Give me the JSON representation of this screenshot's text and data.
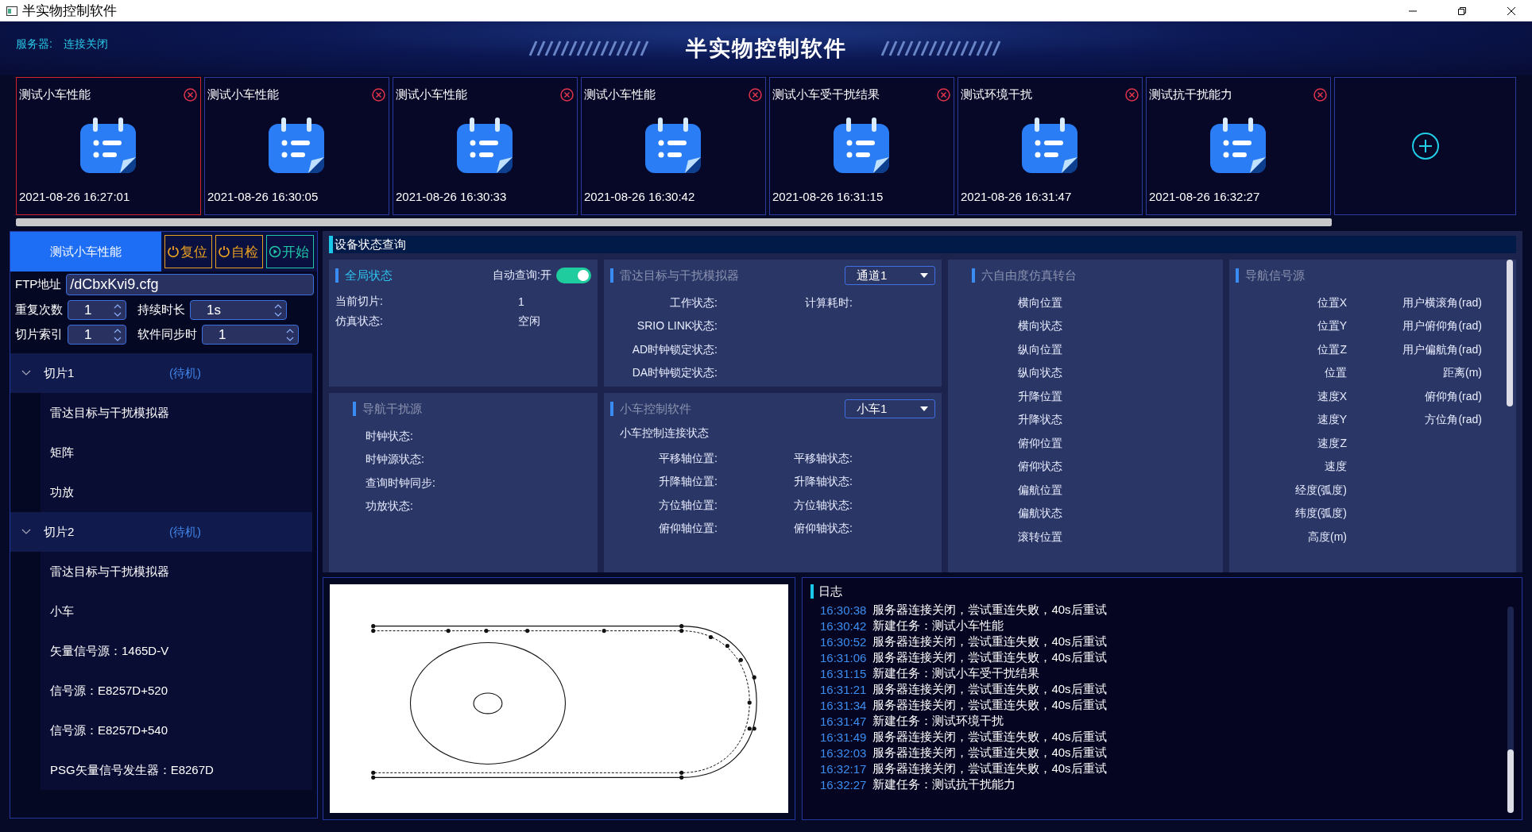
{
  "window": {
    "title": "半实物控制软件"
  },
  "header": {
    "server_label": "服务器:",
    "server_status": "连接关闭",
    "title": "半实物控制软件"
  },
  "tasks": [
    {
      "name": "测试小车性能",
      "time": "2021-08-26 16:27:01",
      "selected": true
    },
    {
      "name": "测试小车性能",
      "time": "2021-08-26 16:30:05",
      "selected": false
    },
    {
      "name": "测试小车性能",
      "time": "2021-08-26 16:30:33",
      "selected": false
    },
    {
      "name": "测试小车性能",
      "time": "2021-08-26 16:30:42",
      "selected": false
    },
    {
      "name": "测试小车受干扰结果",
      "time": "2021-08-26 16:31:15",
      "selected": false
    },
    {
      "name": "测试环境干扰",
      "time": "2021-08-26 16:31:47",
      "selected": false
    },
    {
      "name": "测试抗干扰能力",
      "time": "2021-08-26 16:32:27",
      "selected": false
    }
  ],
  "task_panel": {
    "name": "测试小车性能",
    "buttons": [
      {
        "label": "复位",
        "kind": "reset"
      },
      {
        "label": "自检",
        "kind": "reset"
      },
      {
        "label": "开始",
        "kind": "start"
      }
    ],
    "ftp": {
      "label": "FTP地址",
      "value": "/dCbxKvi9.cfg"
    },
    "fields": [
      {
        "label": "重复次数",
        "value": "1"
      },
      {
        "label": "持续时长",
        "value": "1s"
      },
      {
        "label": "切片索引",
        "value": "1"
      },
      {
        "label": "软件同步时",
        "value": "1"
      }
    ]
  },
  "slices": [
    {
      "name": "切片1",
      "status": "(待机)",
      "expanded": true,
      "children": [
        {
          "name": "雷达目标与干扰模拟器"
        },
        {
          "name": "矩阵"
        },
        {
          "name": "功放"
        }
      ]
    },
    {
      "name": "切片2",
      "status": "(待机)",
      "expanded": true,
      "children": [
        {
          "name": "雷达目标与干扰模拟器"
        },
        {
          "name": "小车"
        },
        {
          "name": "矢量信号源：1465D-V"
        },
        {
          "name": "信号源：E8257D+520"
        },
        {
          "name": "信号源：E8257D+540"
        },
        {
          "name": "PSG矢量信号发生器：E8267D"
        }
      ]
    }
  ],
  "device_status": {
    "title": "设备状态查询",
    "panels": [
      {
        "kind": "summary",
        "title": "全局状态",
        "active": true,
        "toggle": {
          "label": "自动查询:开",
          "on": true
        },
        "rows": [
          [
            "当前切片:",
            "1"
          ],
          [
            "仿真状态:",
            "空闲"
          ]
        ]
      },
      {
        "kind": "pairs",
        "title": "雷达目标与干扰模拟器",
        "active": false,
        "dropdown": "通道1",
        "rows": [
          [
            "工作状态:",
            "计算耗时:"
          ],
          [
            "SRIO LINK状态:"
          ],
          [
            "AD时钟锁定状态:"
          ],
          [
            "DA时钟锁定状态:"
          ]
        ]
      },
      {
        "kind": "list",
        "title": "六自由度仿真转台",
        "active": false,
        "rows": [
          [
            "横向位置"
          ],
          [
            "横向状态"
          ],
          [
            "纵向位置"
          ],
          [
            "纵向状态"
          ],
          [
            "升降位置"
          ],
          [
            "升降状态"
          ],
          [
            "俯仰位置"
          ],
          [
            "俯仰状态"
          ],
          [
            "偏航位置"
          ],
          [
            "偏航状态"
          ],
          [
            "滚转位置"
          ]
        ]
      },
      {
        "kind": "pairs",
        "title": "导航信号源",
        "active": false,
        "rows": [
          [
            "位置X",
            "用户横滚角(rad)"
          ],
          [
            "位置Y",
            "用户俯仰角(rad)"
          ],
          [
            "位置Z",
            "用户偏航角(rad)"
          ],
          [
            "位置",
            "距离(m)"
          ],
          [
            "速度X",
            "俯仰角(rad)"
          ],
          [
            "速度Y",
            "方位角(rad)"
          ],
          [
            "速度Z"
          ],
          [
            "速度"
          ],
          [
            "经度(弧度)"
          ],
          [
            "纬度(弧度)"
          ],
          [
            "高度(m)"
          ]
        ]
      },
      {
        "kind": "list",
        "title": "导航干扰源",
        "active": false,
        "rows": [
          [
            "时钟状态:"
          ],
          [
            "时钟源状态:"
          ],
          [
            "查询时钟同步:"
          ],
          [
            "功放状态:"
          ]
        ]
      },
      {
        "kind": "pairs",
        "title": "小车控制软件",
        "active": false,
        "dropdown": "小车1",
        "lines": [
          "小车控制连接状态"
        ],
        "rows": [
          [
            "平移轴位置:",
            "平移轴状态:"
          ],
          [
            "升降轴位置:",
            "升降轴状态:"
          ],
          [
            "方位轴位置:",
            "方位轴状态:"
          ],
          [
            "俯仰轴位置:",
            "俯仰轴状态:"
          ]
        ]
      }
    ]
  },
  "log": {
    "title": "日志",
    "entries": [
      {
        "time": "16:30:38",
        "message": "服务器连接关闭，尝试重连失败，40s后重试"
      },
      {
        "time": "16:30:42",
        "message": "新建任务：测试小车性能"
      },
      {
        "time": "16:30:52",
        "message": "服务器连接关闭，尝试重连失败，40s后重试"
      },
      {
        "time": "16:31:06",
        "message": "服务器连接关闭，尝试重连失败，40s后重试"
      },
      {
        "time": "16:31:15",
        "message": "新建任务：测试小车受干扰结果"
      },
      {
        "time": "16:31:21",
        "message": "服务器连接关闭，尝试重连失败，40s后重试"
      },
      {
        "time": "16:31:34",
        "message": "服务器连接关闭，尝试重连失败，40s后重试"
      },
      {
        "time": "16:31:47",
        "message": "新建任务：测试环境干扰"
      },
      {
        "time": "16:31:49",
        "message": "服务器连接关闭，尝试重连失败，40s后重试"
      },
      {
        "time": "16:32:03",
        "message": "服务器连接关闭，尝试重连失败，40s后重试"
      },
      {
        "time": "16:32:17",
        "message": "服务器连接关闭，尝试重连失败，40s后重试"
      },
      {
        "time": "16:32:27",
        "message": "新建任务：测试抗干扰能力"
      }
    ]
  }
}
